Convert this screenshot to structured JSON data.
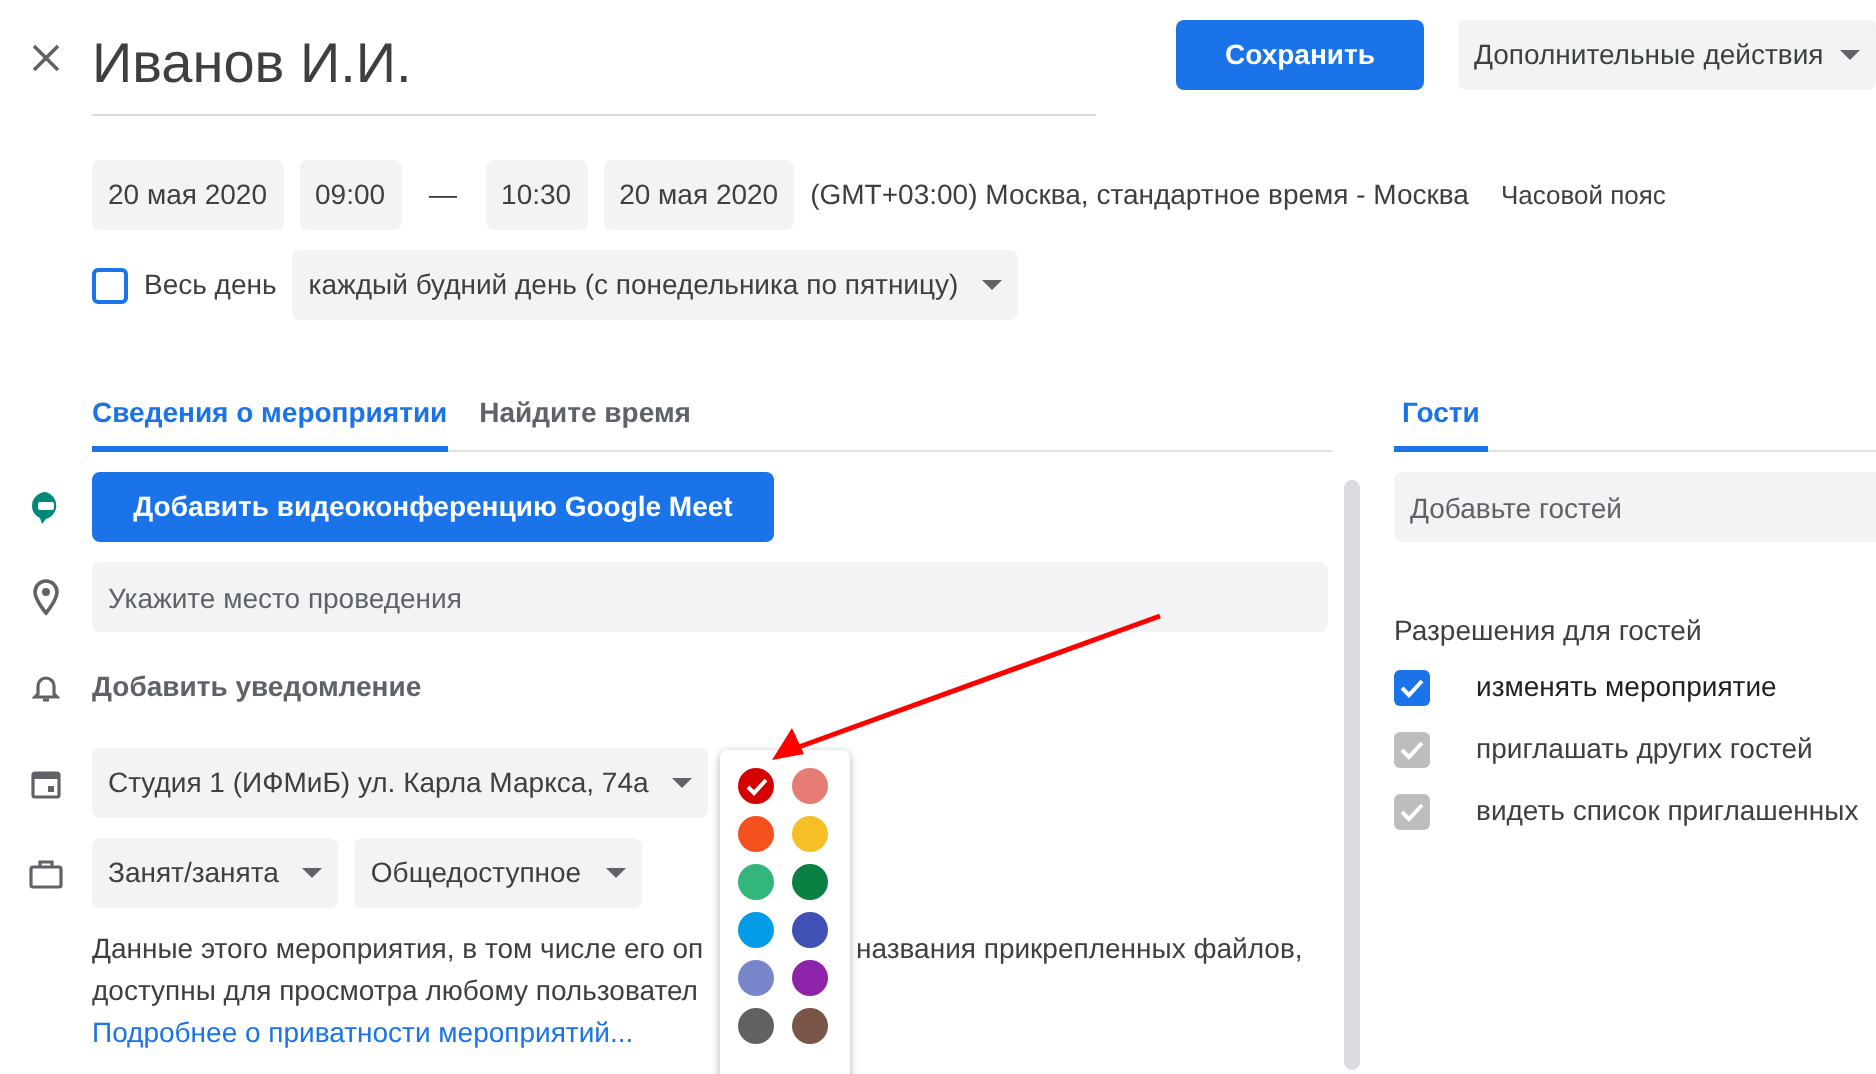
{
  "title": "Иванов И.И.",
  "save_button": "Сохранить",
  "more_actions": "Дополнительные действия",
  "start_date": "20 мая 2020",
  "start_time": "09:00",
  "dash": "—",
  "end_time": "10:30",
  "end_date": "20 мая 2020",
  "timezone_text": "(GMT+03:00) Москва, стандартное время - Москва",
  "timezone_link": "Часовой пояс",
  "all_day": {
    "label": "Весь день",
    "checked": false
  },
  "recurrence": "каждый будний день (с понедельника по пятницу)",
  "tabs": [
    {
      "label": "Сведения о мероприятии",
      "selected": true
    },
    {
      "label": "Найдите время",
      "selected": false
    }
  ],
  "meet_button": "Добавить видеоконференцию Google Meet",
  "location": {
    "placeholder": "Укажите место проведения"
  },
  "notification": "Добавить уведомление",
  "calendar": "Студия 1 (ИФМиБ) ул. Карла Маркса, 74а",
  "busy": "Занят/занята",
  "visibility": "Общедоступное",
  "description": {
    "line1_start": "Данные этого мероприятия, в том числе его оп",
    "line1_end": "названия прикрепленных файлов,",
    "line2": "доступны для просмотра любому пользовател"
  },
  "privacy_link": "Подробнее о приватности мероприятий...",
  "palette": [
    {
      "color": "#d50000",
      "selected": true
    },
    {
      "color": "#e67c73",
      "selected": false
    },
    {
      "color": "#f4511e",
      "selected": false
    },
    {
      "color": "#f6bf26",
      "selected": false
    },
    {
      "color": "#33b679",
      "selected": false
    },
    {
      "color": "#0b8043",
      "selected": false
    },
    {
      "color": "#039be5",
      "selected": false
    },
    {
      "color": "#3f51b5",
      "selected": false
    },
    {
      "color": "#7986cb",
      "selected": false
    },
    {
      "color": "#8e24aa",
      "selected": false
    },
    {
      "color": "#616161",
      "selected": false
    },
    {
      "color": "#795548",
      "selected": false
    }
  ],
  "guests_tab": {
    "label": "Гости",
    "selected": true
  },
  "guests_field": {
    "placeholder": "Добавьте гостей"
  },
  "permissions_title": "Разрешения для гостей",
  "permissions": [
    {
      "label": "изменять мероприятие",
      "checked": true,
      "disabled": false
    },
    {
      "label": "приглашать других гостей",
      "checked": true,
      "disabled": true
    },
    {
      "label": "видеть список приглашенных",
      "checked": true,
      "disabled": true
    }
  ]
}
